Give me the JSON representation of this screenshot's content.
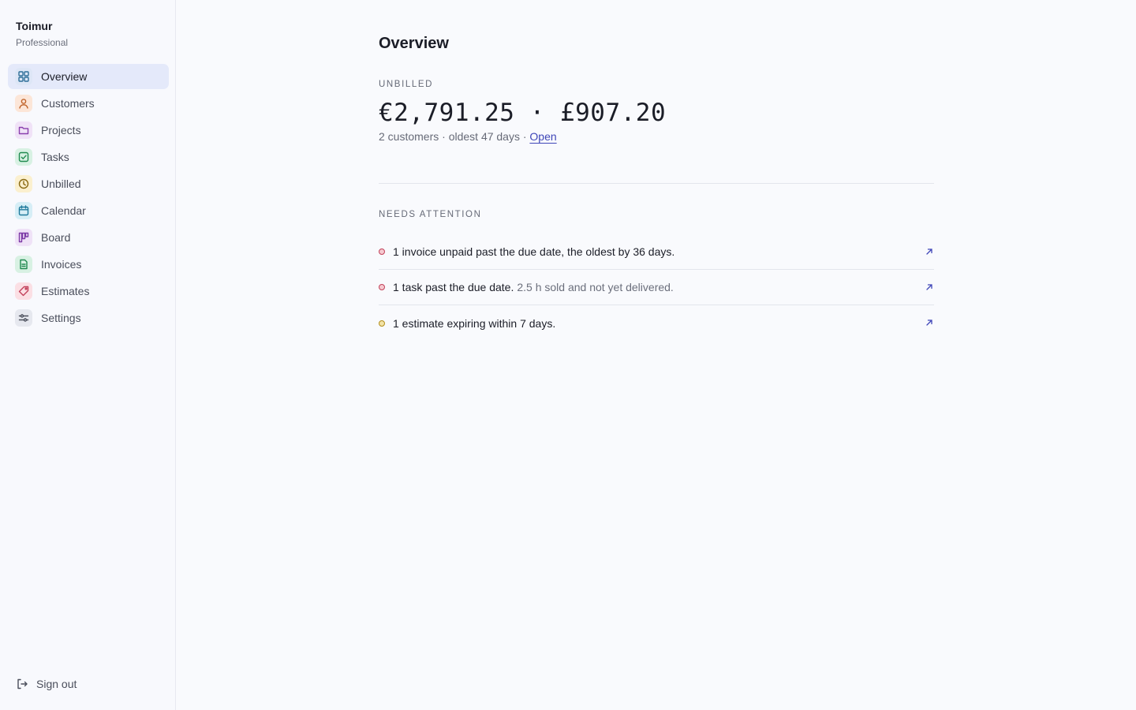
{
  "brand": {
    "name": "Toimur",
    "plan": "Professional"
  },
  "nav": [
    {
      "label": "Overview",
      "icon": "grid-icon",
      "active": true
    },
    {
      "label": "Customers",
      "icon": "person-icon"
    },
    {
      "label": "Projects",
      "icon": "folder-icon"
    },
    {
      "label": "Tasks",
      "icon": "checkbox-icon"
    },
    {
      "label": "Unbilled",
      "icon": "clock-icon"
    },
    {
      "label": "Calendar",
      "icon": "calendar-icon"
    },
    {
      "label": "Board",
      "icon": "kanban-icon"
    },
    {
      "label": "Invoices",
      "icon": "document-icon"
    },
    {
      "label": "Estimates",
      "icon": "tag-icon"
    },
    {
      "label": "Settings",
      "icon": "sliders-icon"
    }
  ],
  "signout": {
    "label": "Sign out",
    "icon": "sign-out-icon"
  },
  "page": {
    "title": "Overview"
  },
  "unbilled": {
    "label": "UNBILLED",
    "amount": "€2,791.25 · £907.20",
    "meta": "2 customers · oldest 47 days ·",
    "link": "Open"
  },
  "attention": {
    "label": "NEEDS ATTENTION",
    "items": [
      {
        "text": "1 invoice unpaid past the due date, the oldest by 36 days.",
        "detail": "",
        "status": "red"
      },
      {
        "text": "1 task past the due date.",
        "detail": "2.5 h sold and not yet delivered.",
        "status": "red"
      },
      {
        "text": "1 estimate expiring within 7 days.",
        "detail": "",
        "status": "yellow"
      }
    ]
  },
  "colors": {
    "accent": "#3f46b8",
    "active_nav_bg": "#e4e9fa",
    "status_red": "#c2415a",
    "status_yellow": "#c9a227"
  }
}
